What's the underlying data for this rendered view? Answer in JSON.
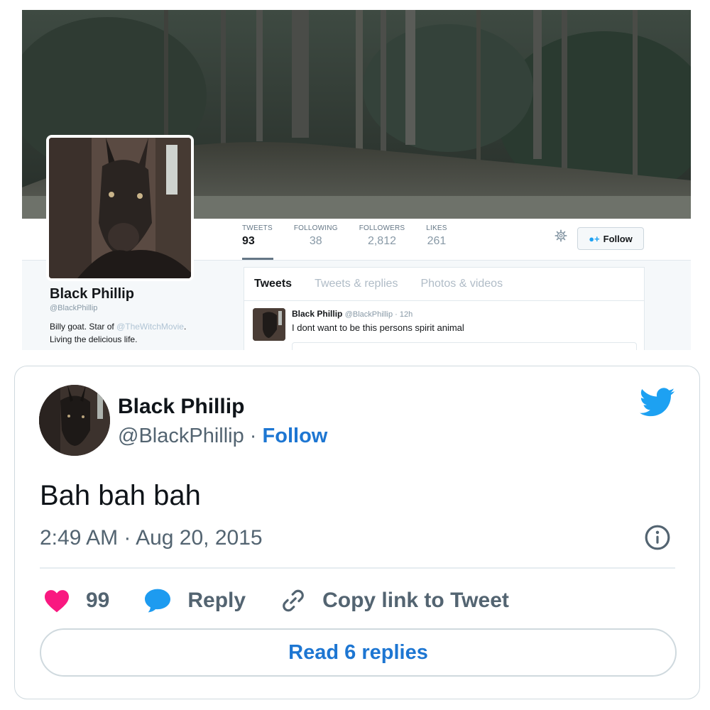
{
  "profile": {
    "stats": [
      {
        "label": "TWEETS",
        "value": "93"
      },
      {
        "label": "FOLLOWING",
        "value": "38"
      },
      {
        "label": "FOLLOWERS",
        "value": "2,812"
      },
      {
        "label": "LIKES",
        "value": "261"
      }
    ],
    "follow_label": "Follow",
    "name": "Black Phillip",
    "handle": "@BlackPhillip",
    "bio_prefix": "Billy goat. Star of",
    "bio_mention": "@TheWitchMovie",
    "bio_suffix": ".",
    "bio_line2": "Living the delicious life.",
    "tabs": [
      "Tweets",
      "Tweets & replies",
      "Photos & videos"
    ],
    "tweet": {
      "name": "Black Phillip",
      "handle_time": "@BlackPhillip · 12h",
      "text": "I dont want to be this persons spirit animal"
    }
  },
  "card": {
    "name": "Black Phillip",
    "handle": "@BlackPhillip",
    "separator": "·",
    "follow_label": "Follow",
    "text": "Bah bah bah",
    "timestamp": "2:49 AM · Aug 20, 2015",
    "likes": "99",
    "reply_label": "Reply",
    "copy_link_label": "Copy link to Tweet",
    "read_replies_label": "Read 6 replies"
  },
  "colors": {
    "link_blue": "#1d76d2",
    "twitter_blue": "#1da1f2",
    "heart_pink": "#f91880",
    "muted_gray": "#536471"
  },
  "icons": [
    "gear-icon",
    "add-person-icon",
    "twitter-bird-icon",
    "info-icon",
    "heart-icon",
    "reply-bubble-icon",
    "link-icon"
  ]
}
